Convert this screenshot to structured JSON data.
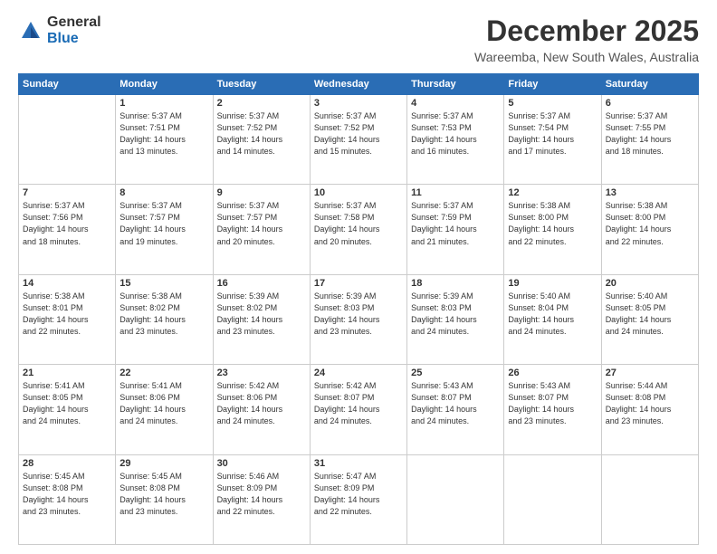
{
  "logo": {
    "general": "General",
    "blue": "Blue"
  },
  "title": {
    "month": "December 2025",
    "location": "Wareemba, New South Wales, Australia"
  },
  "weekdays": [
    "Sunday",
    "Monday",
    "Tuesday",
    "Wednesday",
    "Thursday",
    "Friday",
    "Saturday"
  ],
  "weeks": [
    [
      {
        "day": "",
        "info": ""
      },
      {
        "day": "1",
        "info": "Sunrise: 5:37 AM\nSunset: 7:51 PM\nDaylight: 14 hours\nand 13 minutes."
      },
      {
        "day": "2",
        "info": "Sunrise: 5:37 AM\nSunset: 7:52 PM\nDaylight: 14 hours\nand 14 minutes."
      },
      {
        "day": "3",
        "info": "Sunrise: 5:37 AM\nSunset: 7:52 PM\nDaylight: 14 hours\nand 15 minutes."
      },
      {
        "day": "4",
        "info": "Sunrise: 5:37 AM\nSunset: 7:53 PM\nDaylight: 14 hours\nand 16 minutes."
      },
      {
        "day": "5",
        "info": "Sunrise: 5:37 AM\nSunset: 7:54 PM\nDaylight: 14 hours\nand 17 minutes."
      },
      {
        "day": "6",
        "info": "Sunrise: 5:37 AM\nSunset: 7:55 PM\nDaylight: 14 hours\nand 18 minutes."
      }
    ],
    [
      {
        "day": "7",
        "info": "Sunrise: 5:37 AM\nSunset: 7:56 PM\nDaylight: 14 hours\nand 18 minutes."
      },
      {
        "day": "8",
        "info": "Sunrise: 5:37 AM\nSunset: 7:57 PM\nDaylight: 14 hours\nand 19 minutes."
      },
      {
        "day": "9",
        "info": "Sunrise: 5:37 AM\nSunset: 7:57 PM\nDaylight: 14 hours\nand 20 minutes."
      },
      {
        "day": "10",
        "info": "Sunrise: 5:37 AM\nSunset: 7:58 PM\nDaylight: 14 hours\nand 20 minutes."
      },
      {
        "day": "11",
        "info": "Sunrise: 5:37 AM\nSunset: 7:59 PM\nDaylight: 14 hours\nand 21 minutes."
      },
      {
        "day": "12",
        "info": "Sunrise: 5:38 AM\nSunset: 8:00 PM\nDaylight: 14 hours\nand 22 minutes."
      },
      {
        "day": "13",
        "info": "Sunrise: 5:38 AM\nSunset: 8:00 PM\nDaylight: 14 hours\nand 22 minutes."
      }
    ],
    [
      {
        "day": "14",
        "info": "Sunrise: 5:38 AM\nSunset: 8:01 PM\nDaylight: 14 hours\nand 22 minutes."
      },
      {
        "day": "15",
        "info": "Sunrise: 5:38 AM\nSunset: 8:02 PM\nDaylight: 14 hours\nand 23 minutes."
      },
      {
        "day": "16",
        "info": "Sunrise: 5:39 AM\nSunset: 8:02 PM\nDaylight: 14 hours\nand 23 minutes."
      },
      {
        "day": "17",
        "info": "Sunrise: 5:39 AM\nSunset: 8:03 PM\nDaylight: 14 hours\nand 23 minutes."
      },
      {
        "day": "18",
        "info": "Sunrise: 5:39 AM\nSunset: 8:03 PM\nDaylight: 14 hours\nand 24 minutes."
      },
      {
        "day": "19",
        "info": "Sunrise: 5:40 AM\nSunset: 8:04 PM\nDaylight: 14 hours\nand 24 minutes."
      },
      {
        "day": "20",
        "info": "Sunrise: 5:40 AM\nSunset: 8:05 PM\nDaylight: 14 hours\nand 24 minutes."
      }
    ],
    [
      {
        "day": "21",
        "info": "Sunrise: 5:41 AM\nSunset: 8:05 PM\nDaylight: 14 hours\nand 24 minutes."
      },
      {
        "day": "22",
        "info": "Sunrise: 5:41 AM\nSunset: 8:06 PM\nDaylight: 14 hours\nand 24 minutes."
      },
      {
        "day": "23",
        "info": "Sunrise: 5:42 AM\nSunset: 8:06 PM\nDaylight: 14 hours\nand 24 minutes."
      },
      {
        "day": "24",
        "info": "Sunrise: 5:42 AM\nSunset: 8:07 PM\nDaylight: 14 hours\nand 24 minutes."
      },
      {
        "day": "25",
        "info": "Sunrise: 5:43 AM\nSunset: 8:07 PM\nDaylight: 14 hours\nand 24 minutes."
      },
      {
        "day": "26",
        "info": "Sunrise: 5:43 AM\nSunset: 8:07 PM\nDaylight: 14 hours\nand 23 minutes."
      },
      {
        "day": "27",
        "info": "Sunrise: 5:44 AM\nSunset: 8:08 PM\nDaylight: 14 hours\nand 23 minutes."
      }
    ],
    [
      {
        "day": "28",
        "info": "Sunrise: 5:45 AM\nSunset: 8:08 PM\nDaylight: 14 hours\nand 23 minutes."
      },
      {
        "day": "29",
        "info": "Sunrise: 5:45 AM\nSunset: 8:08 PM\nDaylight: 14 hours\nand 23 minutes."
      },
      {
        "day": "30",
        "info": "Sunrise: 5:46 AM\nSunset: 8:09 PM\nDaylight: 14 hours\nand 22 minutes."
      },
      {
        "day": "31",
        "info": "Sunrise: 5:47 AM\nSunset: 8:09 PM\nDaylight: 14 hours\nand 22 minutes."
      },
      {
        "day": "",
        "info": ""
      },
      {
        "day": "",
        "info": ""
      },
      {
        "day": "",
        "info": ""
      }
    ]
  ]
}
